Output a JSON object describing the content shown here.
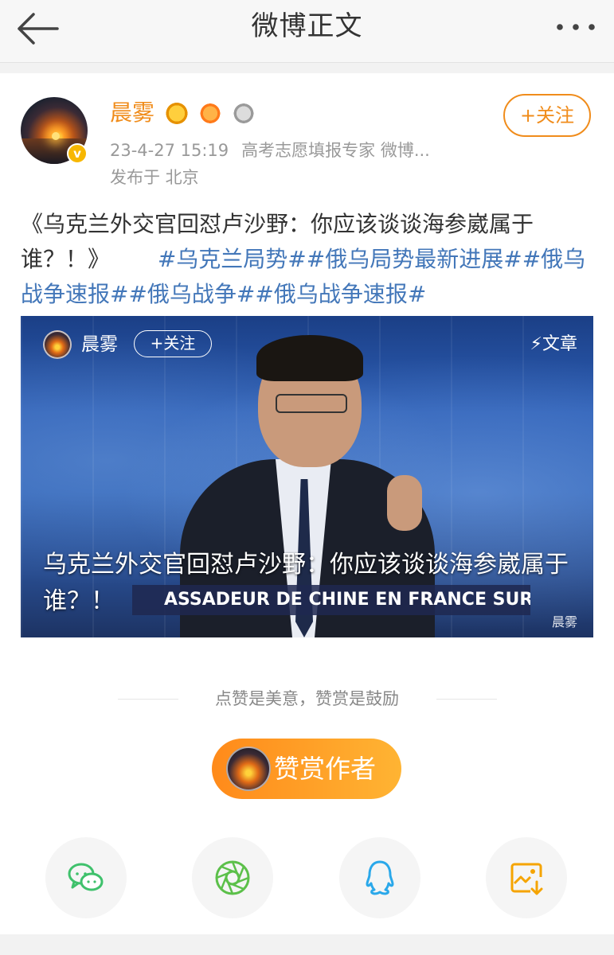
{
  "nav": {
    "title": "微博正文"
  },
  "author": {
    "name": "晨雾",
    "timestamp": "23-4-27 15:19",
    "source": "高考志愿填报专家 微博...",
    "location": "发布于 北京",
    "follow_label": "+关注",
    "verified_mark": "v"
  },
  "post": {
    "title_text": "《乌克兰外交官回怼卢沙野：你应该谈谈海参崴属于谁？！》",
    "hashtags": [
      "#乌克兰局势#",
      "#俄乌局势最新进展#",
      "#俄乌战争速报#",
      "#俄乌战争#",
      "#俄乌战争速报#"
    ]
  },
  "media": {
    "overlay_name": "晨雾",
    "overlay_follow": "+关注",
    "article_label": "⚡文章",
    "caption": "乌克兰外交官回怼卢沙野：你应该谈谈海参崴属于谁？！",
    "lower_third": "ASSADEUR DE CHINE EN FRANCE SUR BFMTV",
    "watermark": "晨雾"
  },
  "reward": {
    "tip": "点赞是美意，赞赏是鼓励",
    "button_label": "赞赏作者"
  },
  "share": {
    "items": [
      {
        "icon": "wechat-icon",
        "color": "#3fc16c"
      },
      {
        "icon": "moments-icon",
        "color": "#5cc04a"
      },
      {
        "icon": "qq-icon",
        "color": "#2aa8ea"
      },
      {
        "icon": "save-image-icon",
        "color": "#f5a400"
      }
    ]
  },
  "colors": {
    "accent": "#f08c1b",
    "link": "#4377b9"
  }
}
